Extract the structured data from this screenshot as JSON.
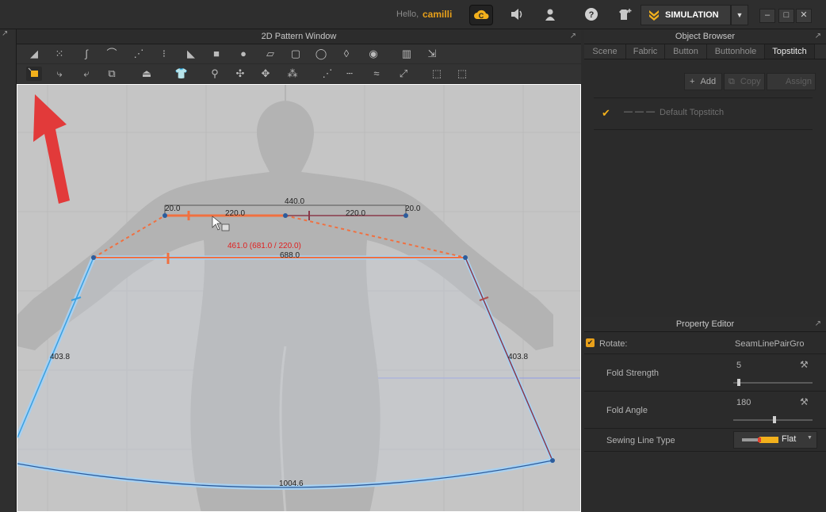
{
  "topbar": {
    "greeting": "Hello,",
    "username": "camilli",
    "simulation_label": "SIMULATION",
    "icons": [
      "clo-cloud-icon",
      "speaker-icon",
      "user-icon",
      "help-icon",
      "avatar-add-icon",
      "simulation-chevron-icon"
    ]
  },
  "pattern_window": {
    "title": "2D Pattern Window"
  },
  "canvas": {
    "labels": {
      "top_width": "440.0",
      "top_left_seg": "220.0",
      "top_right_seg": "220.0",
      "left_corner": "20.0",
      "right_corner": "20.0",
      "red_measure": "461.0 (681.0 / 220.0)",
      "mid_width": "688.0",
      "left_side": "403.8",
      "right_side": "403.8",
      "hem": "1004.6"
    },
    "colors": {
      "seam_orange": "#f07040",
      "selected_blue": "#3aa0e0",
      "dark_line": "#8a3a4a",
      "arrow_red": "#e23a3a"
    }
  },
  "object_browser": {
    "title": "Object Browser",
    "tabs": [
      "Scene",
      "Fabric",
      "Button",
      "Buttonhole",
      "Topstitch"
    ],
    "active_tab": "Topstitch",
    "add_label": "Add",
    "copy_label": "Copy",
    "assign_label": "Assign",
    "default_item": "Default Topstitch",
    "line_sample": "— — —"
  },
  "property_editor": {
    "title": "Property Editor",
    "rotate_label": "Rotate:",
    "rotate_value": "SeamLinePairGro",
    "fold_strength_label": "Fold Strength",
    "fold_strength_value": "5",
    "fold_strength_fraction": 0.05,
    "fold_angle_label": "Fold Angle",
    "fold_angle_value": "180",
    "fold_angle_fraction": 0.5,
    "sewing_type_label": "Sewing Line Type",
    "sewing_type_value": "Flat"
  }
}
